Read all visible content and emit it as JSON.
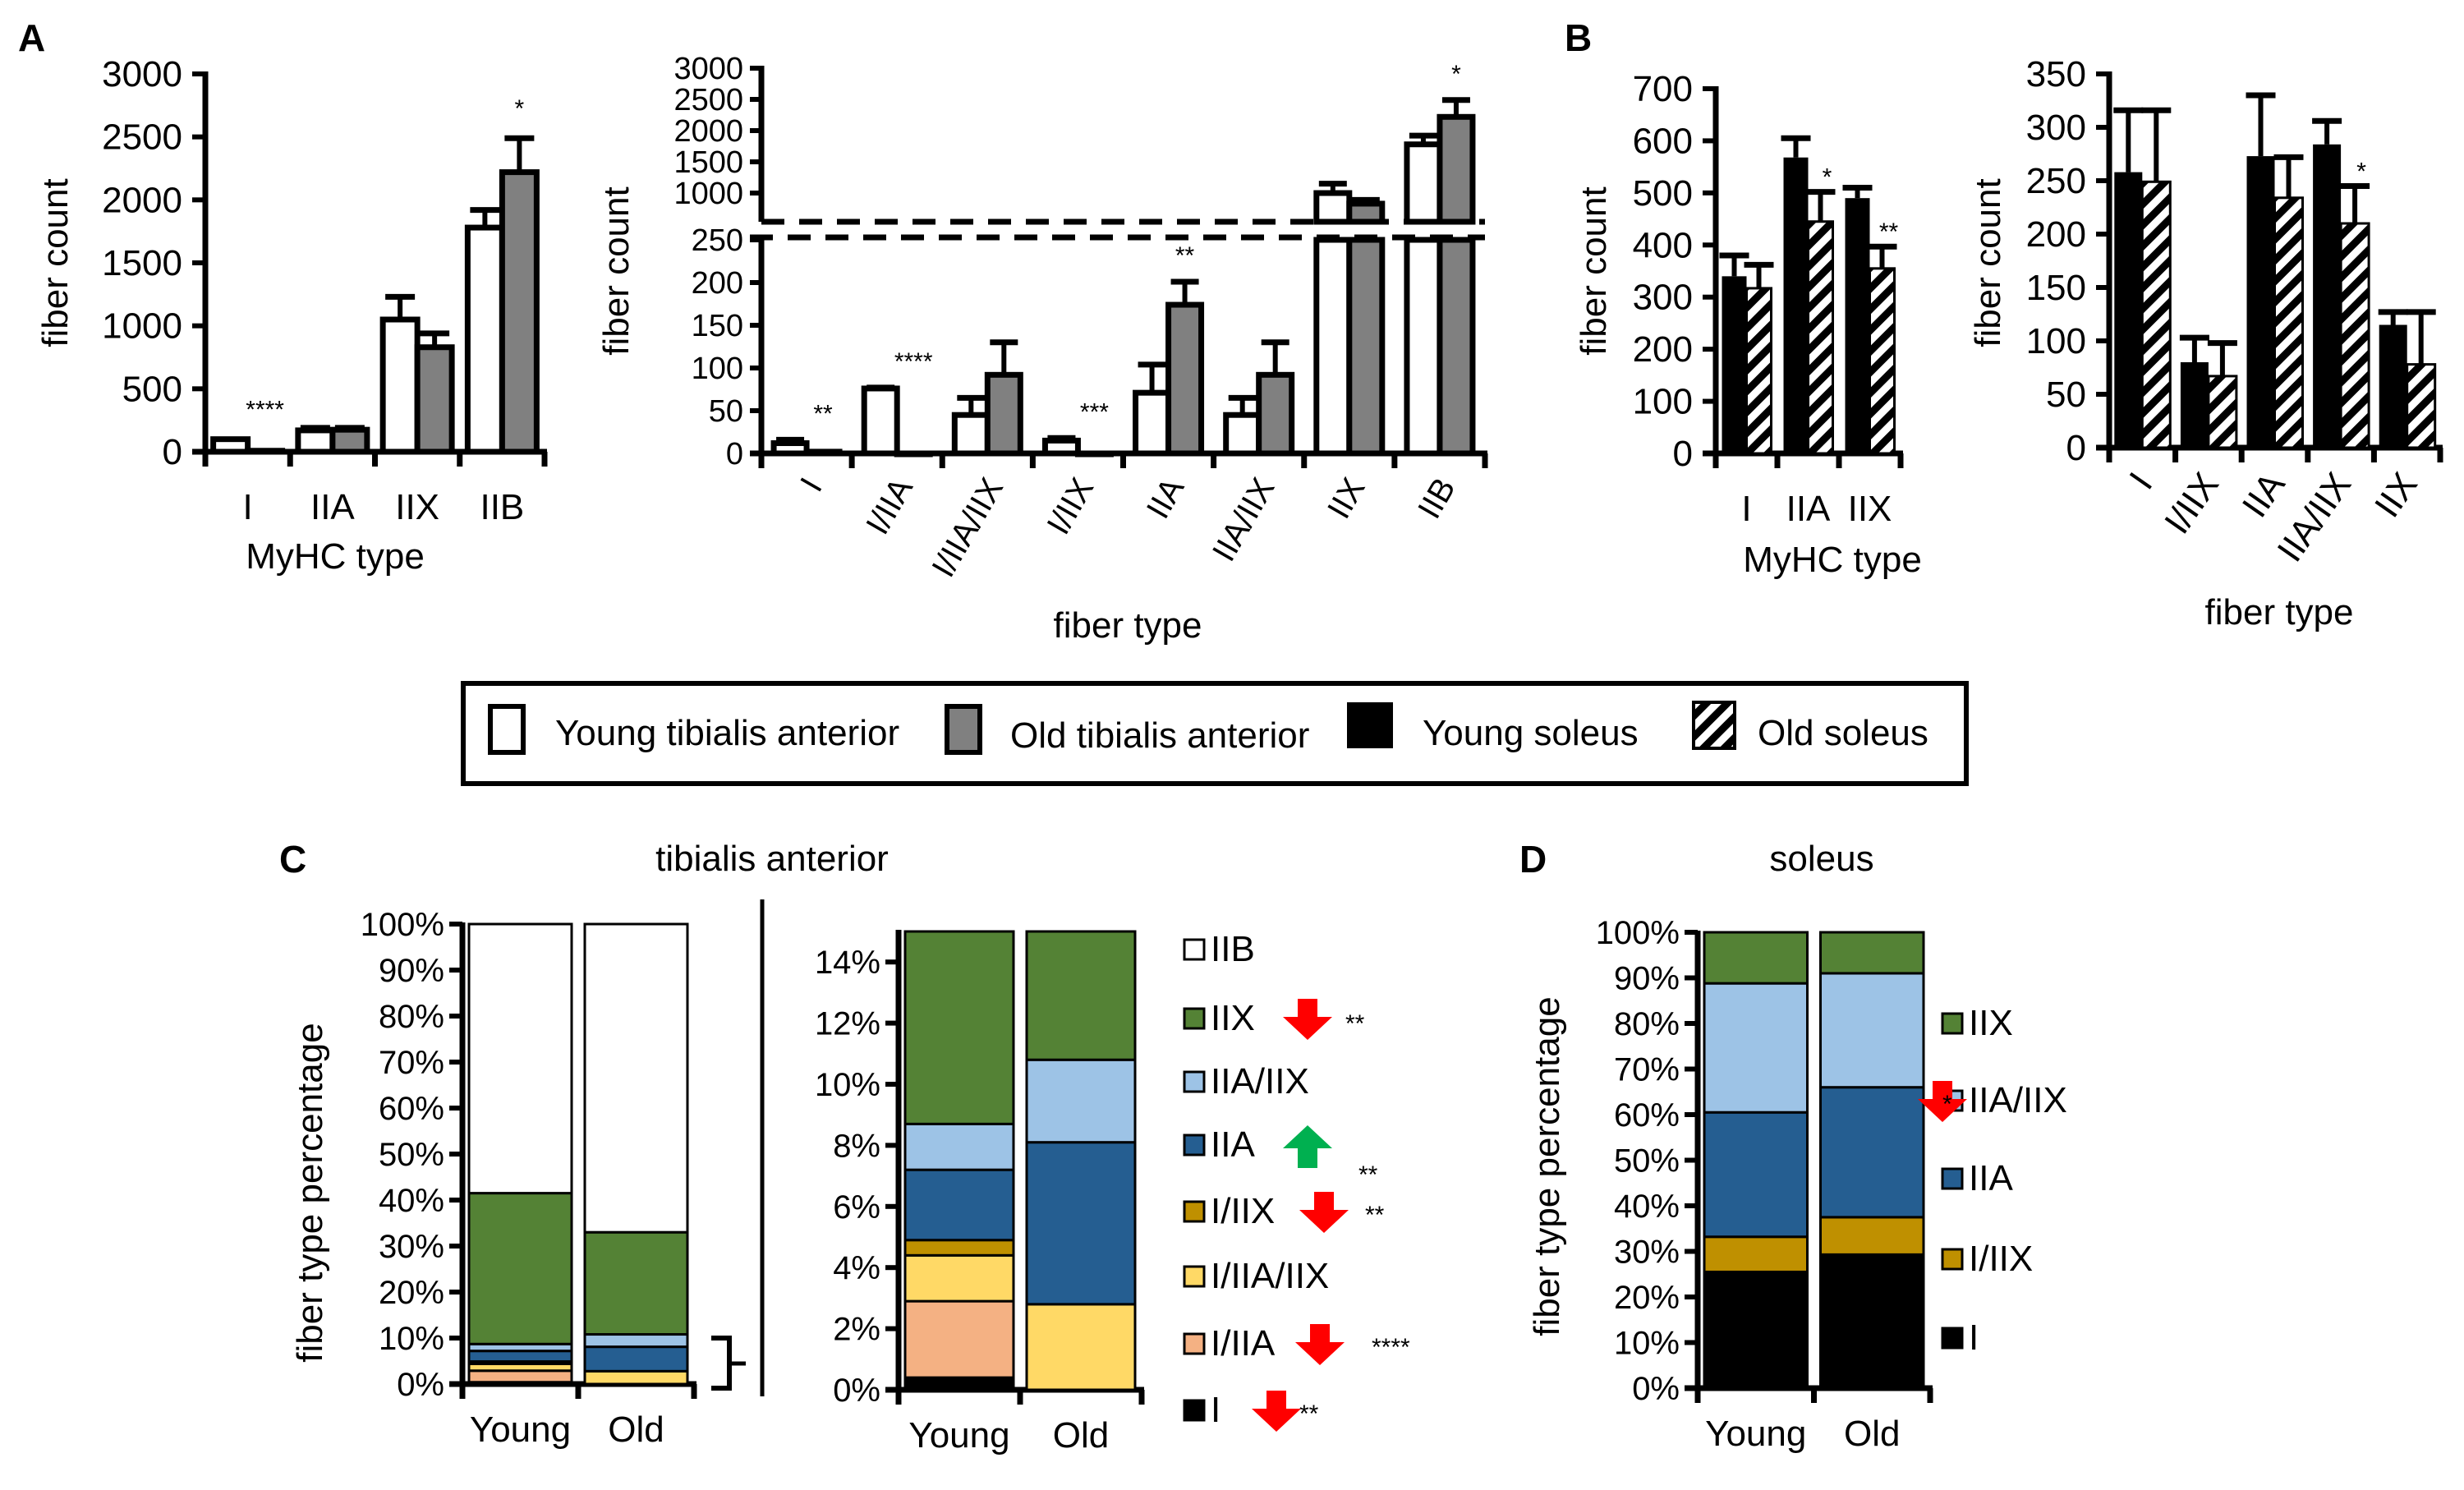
{
  "panels": {
    "A": "A",
    "B": "B",
    "C": "C",
    "D": "D"
  },
  "colors": {
    "young_ta": "#ffffff",
    "old_ta": "#808080",
    "young_sol": "#000000",
    "IIB": "#ffffff",
    "IIX": "#548235",
    "IIA/IIX": "#9dc3e6",
    "IIA": "#255e91",
    "I/IIX": "#bf9000",
    "I/IIA/IIX": "#ffd966",
    "I/IIA": "#f4b183",
    "I": "#000000",
    "arrow_down": "#ff0000",
    "arrow_up": "#00b050"
  },
  "legend": {
    "items": [
      {
        "key": "young_ta",
        "label": "Young tibialis anterior"
      },
      {
        "key": "old_ta",
        "label": "Old tibialis anterior"
      },
      {
        "key": "young_sol",
        "label": "Young soleus"
      },
      {
        "key": "old_sol",
        "label": "Old soleus"
      }
    ]
  },
  "chart_data": [
    {
      "id": "A1",
      "type": "bar",
      "title": "",
      "xlabel": "MyHC type",
      "ylabel": "fiber count",
      "ylim": [
        0,
        3000
      ],
      "yticks": [
        0,
        500,
        1000,
        1500,
        2000,
        2500,
        3000
      ],
      "categories": [
        "I",
        "IIA",
        "IIX",
        "IIB"
      ],
      "series": [
        {
          "name": "Young tibialis anterior",
          "style": "young_ta",
          "values": [
            100,
            170,
            1050,
            1780
          ],
          "errors": [
            0,
            20,
            180,
            140
          ]
        },
        {
          "name": "Old tibialis anterior",
          "style": "old_ta",
          "values": [
            8,
            175,
            830,
            2220
          ],
          "errors": [
            0,
            15,
            110,
            270
          ]
        }
      ],
      "significance": [
        "****",
        "",
        "",
        "*"
      ]
    },
    {
      "id": "A2",
      "type": "bar",
      "title": "",
      "xlabel": "fiber type",
      "ylabel": "fiber count",
      "broken_axis": {
        "lower": [
          0,
          250
        ],
        "upper": [
          540,
          3000
        ]
      },
      "yticks_lower": [
        0,
        50,
        100,
        150,
        200,
        250
      ],
      "yticks_upper": [
        1000,
        1500,
        2000,
        2500,
        3000
      ],
      "categories": [
        "I",
        "I/IIA",
        "I/IIA/IIX",
        "I/IIX",
        "IIA",
        "IIA/IIX",
        "IIX",
        "IIB"
      ],
      "series": [
        {
          "name": "Young tibialis anterior",
          "style": "young_ta",
          "values": [
            12,
            76,
            45,
            15,
            71,
            45,
            1000,
            1780
          ],
          "errors": [
            4,
            1,
            20,
            3,
            33,
            20,
            150,
            140
          ]
        },
        {
          "name": "Old tibialis anterior",
          "style": "old_ta",
          "values": [
            2,
            0,
            92,
            0,
            174,
            92,
            830,
            2220
          ],
          "errors": [
            0,
            0,
            38,
            0,
            27,
            38,
            60,
            270
          ]
        }
      ],
      "significance": [
        "**",
        "****",
        "",
        "***",
        "**",
        "",
        "",
        "*"
      ]
    },
    {
      "id": "B1",
      "type": "bar",
      "title": "",
      "xlabel": "MyHC type",
      "ylabel": "fiber count",
      "ylim": [
        0,
        700
      ],
      "yticks": [
        0,
        100,
        200,
        300,
        400,
        500,
        600,
        700
      ],
      "categories": [
        "I",
        "IIA",
        "IIX"
      ],
      "series": [
        {
          "name": "Young soleus",
          "style": "young_sol",
          "values": [
            340,
            568,
            490
          ],
          "errors": [
            40,
            37,
            20
          ]
        },
        {
          "name": "Old soleus",
          "style": "old_sol",
          "values": [
            317,
            445,
            355
          ],
          "errors": [
            45,
            57,
            42
          ]
        }
      ],
      "significance": [
        "",
        "*",
        "**"
      ]
    },
    {
      "id": "B2",
      "type": "bar",
      "title": "",
      "xlabel": "fiber type",
      "ylabel": "fiber count",
      "ylim": [
        0,
        350
      ],
      "yticks": [
        0,
        50,
        100,
        150,
        200,
        250,
        300,
        350
      ],
      "categories": [
        "I",
        "I/IIX",
        "IIA",
        "IIA/IIX",
        "IIX"
      ],
      "series": [
        {
          "name": "Young soleus",
          "style": "young_sol",
          "values": [
            258,
            80,
            273,
            284,
            115
          ],
          "errors": [
            58,
            23,
            57,
            22,
            12
          ]
        },
        {
          "name": "Old soleus",
          "style": "old_sol",
          "values": [
            249,
            67,
            234,
            210,
            78
          ],
          "errors": [
            67,
            31,
            38,
            35,
            49
          ]
        }
      ],
      "significance": [
        "",
        "",
        "",
        "*",
        ""
      ]
    },
    {
      "id": "C1",
      "type": "bar",
      "stacked": true,
      "title": "tibialis anterior",
      "xlabel": "",
      "ylabel": "fiber type percentage",
      "ylim": [
        0,
        100
      ],
      "yticks": [
        "0%",
        "10%",
        "20%",
        "30%",
        "40%",
        "50%",
        "60%",
        "70%",
        "80%",
        "90%",
        "100%"
      ],
      "categories": [
        "Young",
        "Old"
      ],
      "series": [
        {
          "name": "I",
          "values": [
            0.4,
            0.0
          ]
        },
        {
          "name": "I/IIA",
          "values": [
            2.5,
            0.0
          ]
        },
        {
          "name": "I/IIA/IIX",
          "values": [
            1.5,
            2.8
          ]
        },
        {
          "name": "I/IIX",
          "values": [
            0.5,
            0.0
          ]
        },
        {
          "name": "IIA",
          "values": [
            2.3,
            5.3
          ]
        },
        {
          "name": "IIA/IIX",
          "values": [
            1.5,
            2.7
          ]
        },
        {
          "name": "IIX",
          "values": [
            32.8,
            22.2
          ]
        },
        {
          "name": "IIB",
          "values": [
            58.5,
            67.0
          ]
        }
      ]
    },
    {
      "id": "C2",
      "type": "bar",
      "stacked": true,
      "title": "",
      "xlabel": "",
      "ylabel": "",
      "ylim": [
        0,
        15
      ],
      "yticks": [
        "0%",
        "2%",
        "4%",
        "6%",
        "8%",
        "10%",
        "12%",
        "14%"
      ],
      "categories": [
        "Young",
        "Old"
      ],
      "series": [
        {
          "name": "I",
          "values": [
            0.4,
            0.0
          ]
        },
        {
          "name": "I/IIA",
          "values": [
            2.5,
            0.0
          ]
        },
        {
          "name": "I/IIA/IIX",
          "values": [
            1.5,
            2.8
          ]
        },
        {
          "name": "I/IIX",
          "values": [
            0.5,
            0.0
          ]
        },
        {
          "name": "IIA",
          "values": [
            2.3,
            5.3
          ]
        },
        {
          "name": "IIA/IIX",
          "values": [
            1.5,
            2.7
          ]
        },
        {
          "name": "IIX",
          "values": [
            32.8,
            22.2
          ]
        },
        {
          "name": "IIB",
          "values": [
            58.5,
            67.0
          ]
        }
      ],
      "legend": [
        {
          "name": "IIB",
          "change": "",
          "sig": ""
        },
        {
          "name": "IIX",
          "change": "down",
          "sig": "**"
        },
        {
          "name": "IIA/IIX",
          "change": "",
          "sig": ""
        },
        {
          "name": "IIA",
          "change": "up",
          "sig": "**"
        },
        {
          "name": "I/IIX",
          "change": "down",
          "sig": "**"
        },
        {
          "name": "I/IIA/IIX",
          "change": "",
          "sig": ""
        },
        {
          "name": "I/IIA",
          "change": "down",
          "sig": "****"
        },
        {
          "name": "I",
          "change": "down",
          "sig": "**"
        }
      ]
    },
    {
      "id": "D",
      "type": "bar",
      "stacked": true,
      "title": "soleus",
      "xlabel": "",
      "ylabel": "fiber type  percentage",
      "ylim": [
        0,
        100
      ],
      "yticks": [
        "0%",
        "10%",
        "20%",
        "30%",
        "40%",
        "50%",
        "60%",
        "70%",
        "80%",
        "90%",
        "100%"
      ],
      "categories": [
        "Young",
        "Old"
      ],
      "series": [
        {
          "name": "I",
          "values": [
            25.5,
            29.3
          ]
        },
        {
          "name": "I/IIX",
          "values": [
            7.7,
            8.2
          ]
        },
        {
          "name": "IIA",
          "values": [
            27.3,
            28.5
          ]
        },
        {
          "name": "IIA/IIX",
          "values": [
            28.3,
            25.0
          ]
        },
        {
          "name": "IIX",
          "values": [
            11.2,
            9.0
          ]
        }
      ],
      "legend": [
        {
          "name": "IIX",
          "change": "",
          "sig": ""
        },
        {
          "name": "IIA/IIX",
          "change": "down",
          "sig": "*"
        },
        {
          "name": "IIA",
          "change": "",
          "sig": ""
        },
        {
          "name": "I/IIX",
          "change": "",
          "sig": ""
        },
        {
          "name": "I",
          "change": "",
          "sig": ""
        }
      ]
    }
  ]
}
